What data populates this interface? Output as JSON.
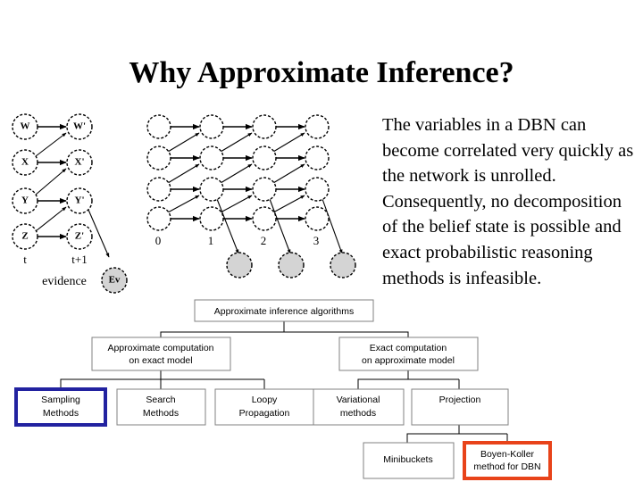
{
  "slide": {
    "title": "Why Approximate Inference?",
    "background_color": "#ffffff"
  },
  "body": {
    "paragraph": "The variables in a DBN can become correlated very quickly as the network is unrolled.  Consequently, no decomposition of the belief state is possible and exact probabilistic reasoning methods is infeasible."
  },
  "two_slice_dbn": {
    "nodes_t": [
      "W",
      "X",
      "Y",
      "Z"
    ],
    "nodes_t_next": [
      "W'",
      "X'",
      "Y'",
      "Z'"
    ],
    "time_label_left": "t",
    "time_label_right": "t+1",
    "evidence_label": "evidence",
    "evidence_node": "Ev"
  },
  "unrolled_dbn": {
    "time_labels": [
      "0",
      "1",
      "2",
      "3"
    ],
    "rows": 4,
    "columns": 4,
    "evidence_node_count": 3
  },
  "taxonomy": {
    "root": "Approximate inference algorithms",
    "level2": [
      "Approximate computation\non exact model",
      "Exact computation\non approximate model"
    ],
    "level2_left_line1": "Approximate computation",
    "level2_left_line2": "on exact model",
    "level2_right_line1": "Exact computation",
    "level2_right_line2": "on approximate model",
    "leaves": [
      {
        "line1": "Sampling",
        "line2": "Methods",
        "highlight": "blue"
      },
      {
        "line1": "Search",
        "line2": "Methods",
        "highlight": "none"
      },
      {
        "line1": "Loopy",
        "line2": "Propagation",
        "highlight": "none"
      },
      {
        "line1": "Variational",
        "line2": "methods",
        "highlight": "none"
      },
      {
        "line1": "Projection",
        "line2": "",
        "highlight": "none"
      }
    ],
    "sublevel": [
      {
        "line1": "Minibuckets",
        "line2": "",
        "highlight": "none"
      },
      {
        "line1": "Boyen-Koller",
        "line2": "method for DBN",
        "highlight": "red"
      }
    ],
    "highlight_colors": {
      "blue": "#2222a0",
      "red": "#e8431a",
      "default_border": "#808080"
    }
  }
}
